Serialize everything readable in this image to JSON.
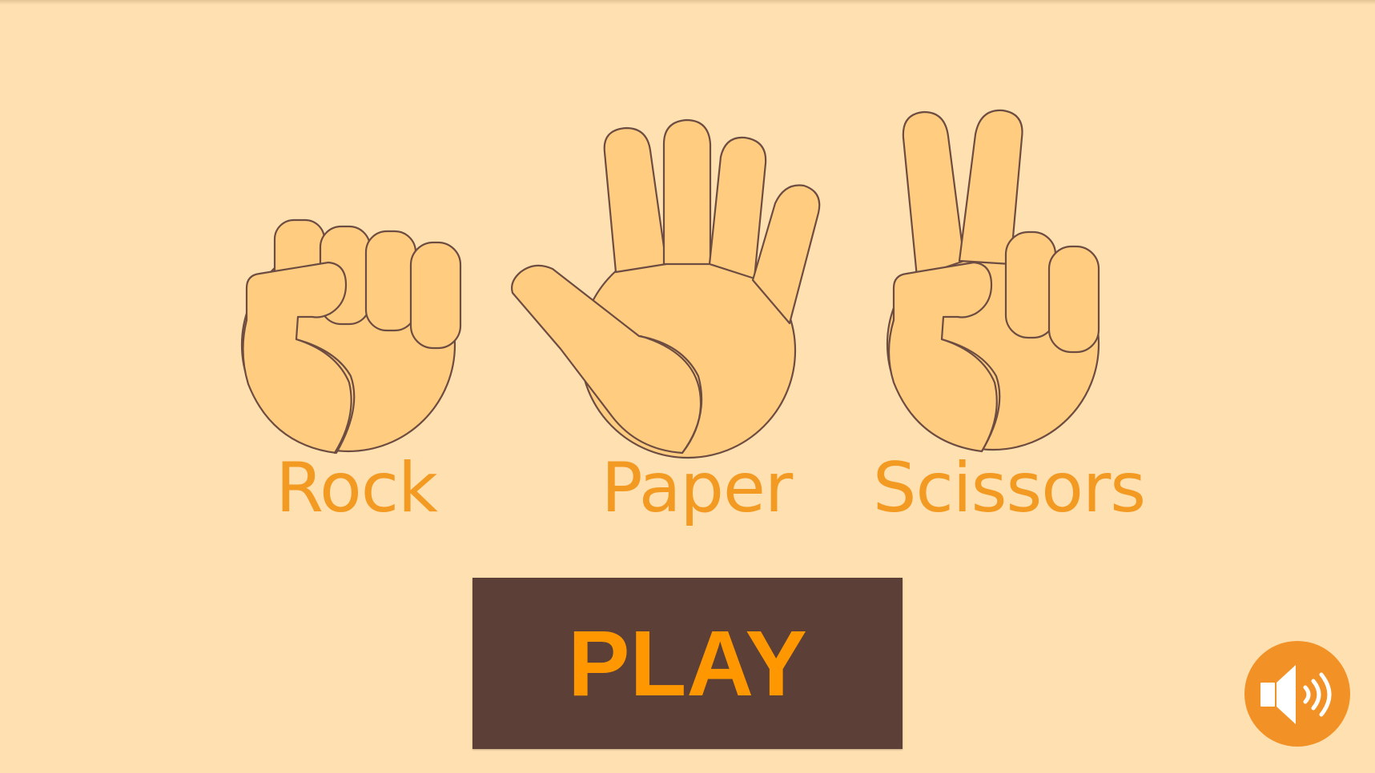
{
  "hands": [
    {
      "id": "rock",
      "label": "Rock",
      "icon": "fist-icon"
    },
    {
      "id": "paper",
      "label": "Paper",
      "icon": "open-hand-icon"
    },
    {
      "id": "scissors",
      "label": "Scissors",
      "icon": "victory-hand-icon"
    }
  ],
  "play_button": {
    "label": "PLAY"
  },
  "sound_button": {
    "icon": "speaker-icon",
    "state": "on"
  },
  "colors": {
    "background": "#FFE0B0",
    "skin": "#FFCC80",
    "outline": "#6D4C41",
    "label": "#F39A22",
    "play_bg": "#5C4037",
    "play_text": "#FF9800",
    "sound_bg": "#F29126",
    "sound_icon": "#FFFFFF"
  }
}
